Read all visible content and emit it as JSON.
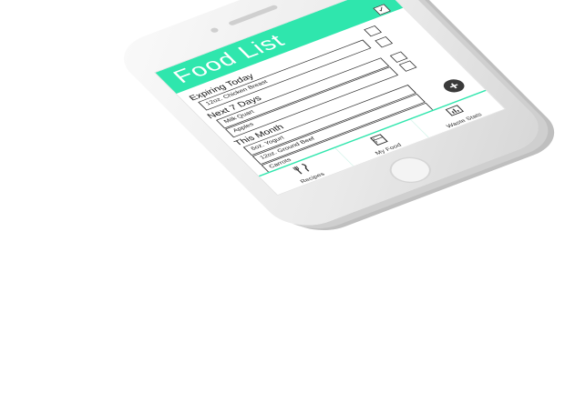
{
  "app": {
    "title": "Food List"
  },
  "sections": [
    {
      "title": "Expiring Today",
      "items": [
        {
          "label": "12oz. Chicken Breast"
        }
      ]
    },
    {
      "title": "Next 7 Days",
      "items": [
        {
          "label": "Milk Quart"
        },
        {
          "label": "Apples"
        }
      ]
    },
    {
      "title": "This Month",
      "items": [
        {
          "label": "6oz. Yogurt"
        },
        {
          "label": "12oz. Ground Beef"
        },
        {
          "label": "Carrots"
        }
      ]
    }
  ],
  "fab": {
    "symbol": "+",
    "icon": "plus-icon"
  },
  "nav": {
    "items": [
      {
        "label": "Recipes",
        "icon": "fork-knife-icon"
      },
      {
        "label": "My Food",
        "icon": "fridge-icon"
      },
      {
        "label": "Waste Stats",
        "icon": "bar-chart-icon"
      }
    ]
  },
  "colors": {
    "accent": "#2fe6ad",
    "fab": "#3a3a3a"
  }
}
